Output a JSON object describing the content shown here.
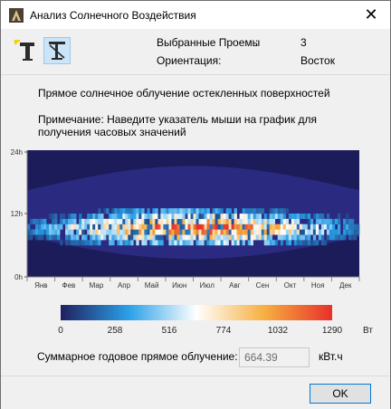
{
  "window": {
    "title": "Анализ Солнечного Воздействия",
    "close_glyph": "✕"
  },
  "toolbar": {
    "buttons": [
      {
        "icon": "sun-window-icon",
        "active": false
      },
      {
        "icon": "window-shade-icon",
        "active": true
      }
    ]
  },
  "info": {
    "selected_label": "Выбранные Проемы",
    "selected_colon": ":",
    "selected_value": "3",
    "orientation_label": "Ориентация:",
    "orientation_value": "Восток"
  },
  "heading": "Прямое солнечное облучение остекленных поверхностей",
  "note_line1": "Примечание: Наведите указатель мыши на график для",
  "note_line2": "получения часовых значений",
  "chart_data": {
    "type": "heatmap",
    "y_ticks": [
      "24h",
      "12h",
      "0h"
    ],
    "months": [
      "Янв",
      "Фев",
      "Мар",
      "Апр",
      "Май",
      "Июн",
      "Июл",
      "Авг",
      "Сен",
      "Окт",
      "Ноя",
      "Дек"
    ],
    "colorbar": {
      "ticks": [
        "0",
        "258",
        "516",
        "774",
        "1032",
        "1290"
      ],
      "unit": "Вт",
      "min": 0,
      "max": 1290,
      "colors": [
        "#20205e",
        "#2aa0e8",
        "#ffffff",
        "#f6b040",
        "#e8302a"
      ]
    },
    "grid": true
  },
  "total": {
    "label": "Суммарное годовое прямое облучение:",
    "value": "664.39",
    "unit": "кВт.ч"
  },
  "ok_label": "OK"
}
